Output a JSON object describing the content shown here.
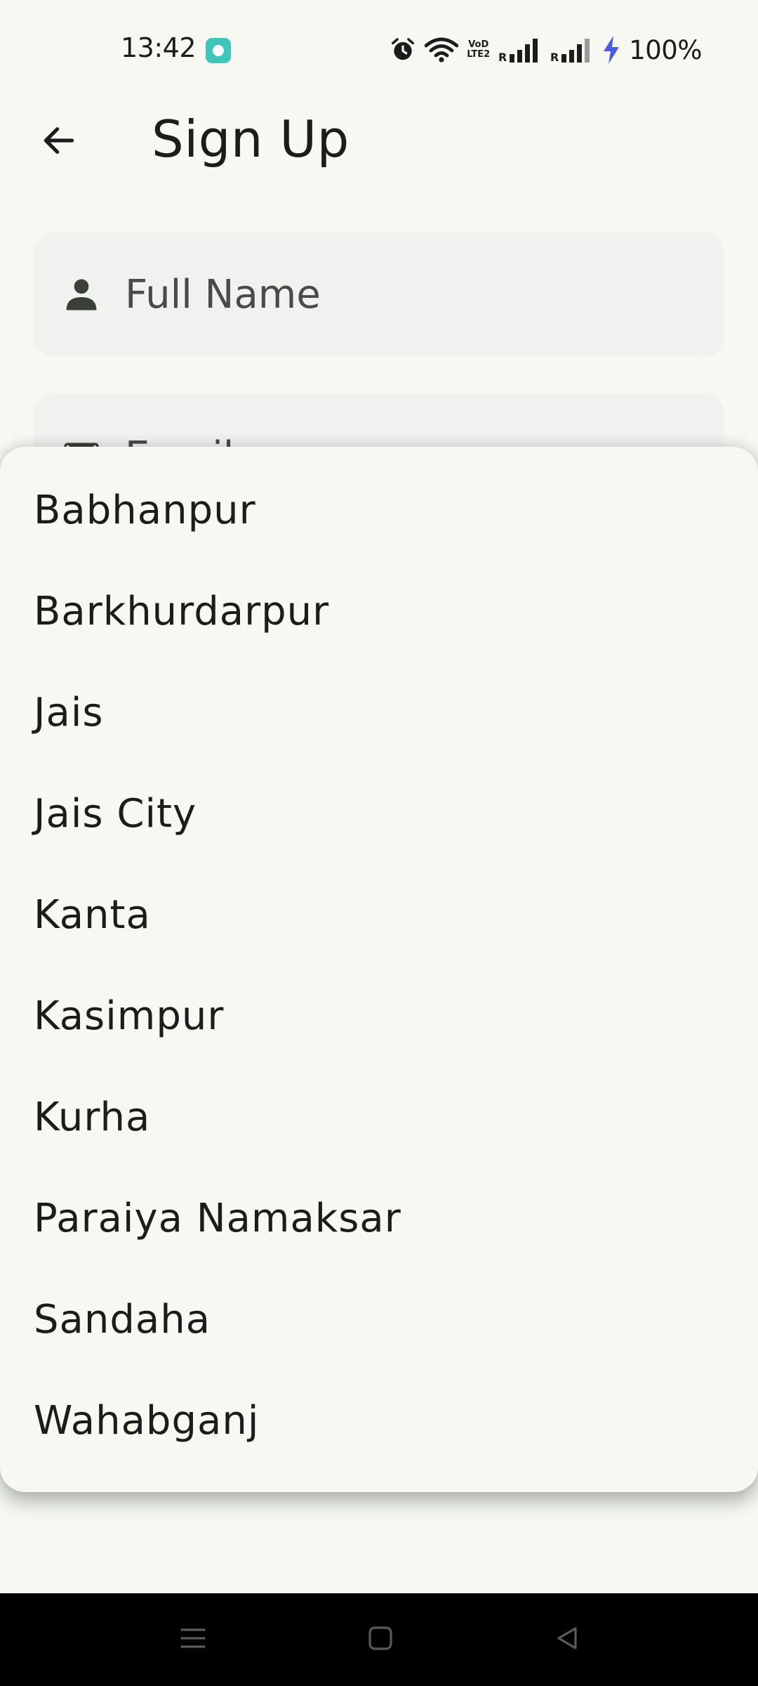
{
  "status_bar": {
    "time": "13:42",
    "battery": "100%",
    "network_label_top": "VoD",
    "network_label_bottom": "LTE2",
    "icons": [
      "notification-app-icon",
      "alarm-icon",
      "wifi-icon",
      "signal-sim1-icon",
      "signal-sim2-icon",
      "charging-icon"
    ]
  },
  "app_bar": {
    "title": "Sign Up",
    "back_icon": "arrow-left-icon"
  },
  "form": {
    "full_name": {
      "placeholder": "Full Name",
      "value": "",
      "icon": "person-icon"
    },
    "email": {
      "placeholder": "Email",
      "value": "",
      "icon": "mail-icon"
    }
  },
  "dropdown": {
    "items": [
      {
        "label": "Babhanpur"
      },
      {
        "label": "Barkhurdarpur"
      },
      {
        "label": "Jais"
      },
      {
        "label": "Jais City"
      },
      {
        "label": "Kanta"
      },
      {
        "label": "Kasimpur"
      },
      {
        "label": "Kurha"
      },
      {
        "label": "Paraiya Namaksar"
      },
      {
        "label": "Sandaha"
      },
      {
        "label": "Wahabganj"
      }
    ]
  },
  "nav_bar": {
    "icons": [
      "recents-menu-icon",
      "home-square-icon",
      "back-triangle-icon"
    ]
  },
  "colors": {
    "background": "#f6f8f1",
    "field_background": "#f1f2f0",
    "text": "#1c1c1c",
    "charging": "#4a5de0",
    "app_icon": "#3fc5b9"
  }
}
